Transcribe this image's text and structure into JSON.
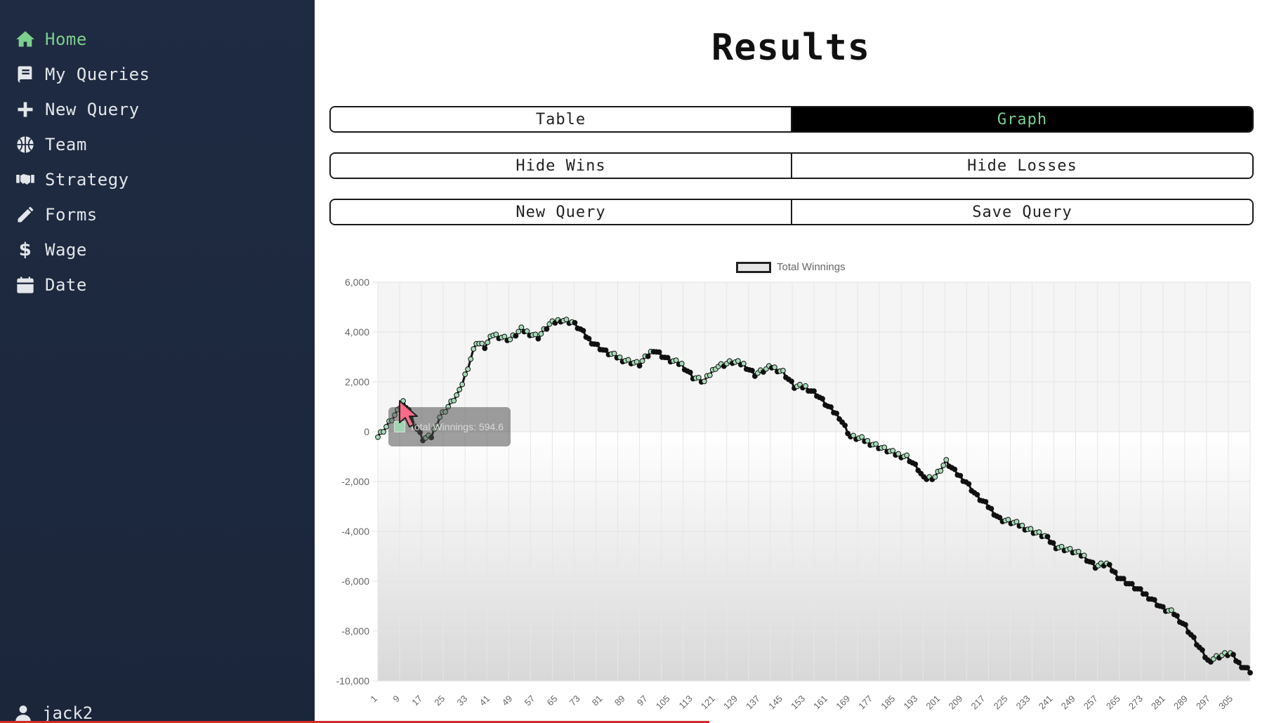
{
  "sidebar": {
    "items": [
      {
        "label": "Home",
        "icon": "home-icon",
        "active": true
      },
      {
        "label": "My Queries",
        "icon": "book-icon"
      },
      {
        "label": "New Query",
        "icon": "plus-icon"
      },
      {
        "label": "Team",
        "icon": "basketball-icon"
      },
      {
        "label": "Strategy",
        "icon": "handshake-icon"
      },
      {
        "label": "Forms",
        "icon": "pencil-icon"
      },
      {
        "label": "Wage",
        "icon": "dollar-icon"
      },
      {
        "label": "Date",
        "icon": "calendar-icon"
      }
    ],
    "user": "jack2",
    "accent": "#7ccf8d"
  },
  "main": {
    "title": "Results",
    "view_toggle": {
      "table": "Table",
      "graph": "Graph",
      "selected": "Graph"
    },
    "filters": {
      "hide_wins": "Hide Wins",
      "hide_losses": "Hide Losses"
    },
    "actions": {
      "new_query": "New Query",
      "save_query": "Save Query"
    }
  },
  "tooltip": {
    "text": "Total Winnings: 594.6"
  },
  "chart_data": {
    "type": "line",
    "series": [
      {
        "name": "Total Winnings"
      }
    ],
    "x_start": 1,
    "x_end": 311,
    "x_tick_labels": [
      "1",
      "9",
      "17",
      "25",
      "33",
      "41",
      "49",
      "57",
      "65",
      "73",
      "81",
      "89",
      "97",
      "105",
      "113",
      "121",
      "129",
      "137",
      "145",
      "153",
      "161",
      "169",
      "177",
      "185",
      "193",
      "201",
      "209",
      "217",
      "225",
      "233",
      "241",
      "249",
      "257",
      "265",
      "273",
      "281",
      "289",
      "297",
      "305"
    ],
    "y_ticks": [
      6000,
      4000,
      2000,
      0,
      -2000,
      -4000,
      -6000,
      -8000,
      -10000
    ],
    "ylim": [
      -10000,
      6000
    ],
    "trend_points": [
      [
        1,
        -200
      ],
      [
        4,
        200
      ],
      [
        8,
        800
      ],
      [
        10,
        1200
      ],
      [
        12,
        900
      ],
      [
        14,
        300
      ],
      [
        17,
        -300
      ],
      [
        20,
        -200
      ],
      [
        23,
        600
      ],
      [
        26,
        1000
      ],
      [
        30,
        1600
      ],
      [
        33,
        2600
      ],
      [
        36,
        3600
      ],
      [
        39,
        3400
      ],
      [
        42,
        3900
      ],
      [
        48,
        3700
      ],
      [
        52,
        4100
      ],
      [
        58,
        3800
      ],
      [
        62,
        4300
      ],
      [
        66,
        4500
      ],
      [
        70,
        4400
      ],
      [
        73,
        4100
      ],
      [
        76,
        3700
      ],
      [
        82,
        3200
      ],
      [
        88,
        2900
      ],
      [
        94,
        2700
      ],
      [
        99,
        3300
      ],
      [
        104,
        2900
      ],
      [
        109,
        2700
      ],
      [
        113,
        2200
      ],
      [
        117,
        2000
      ],
      [
        121,
        2600
      ],
      [
        127,
        2800
      ],
      [
        131,
        2700
      ],
      [
        135,
        2300
      ],
      [
        141,
        2600
      ],
      [
        145,
        2400
      ],
      [
        149,
        1800
      ],
      [
        153,
        1800
      ],
      [
        157,
        1500
      ],
      [
        161,
        1000
      ],
      [
        165,
        600
      ],
      [
        169,
        -200
      ],
      [
        173,
        -300
      ],
      [
        177,
        -500
      ],
      [
        181,
        -700
      ],
      [
        185,
        -900
      ],
      [
        189,
        -1000
      ],
      [
        193,
        -1500
      ],
      [
        195,
        -1900
      ],
      [
        199,
        -1800
      ],
      [
        203,
        -1200
      ],
      [
        206,
        -1600
      ],
      [
        210,
        -2000
      ],
      [
        214,
        -2600
      ],
      [
        218,
        -3000
      ],
      [
        222,
        -3500
      ],
      [
        228,
        -3700
      ],
      [
        234,
        -4000
      ],
      [
        238,
        -4200
      ],
      [
        242,
        -4600
      ],
      [
        248,
        -4800
      ],
      [
        252,
        -5000
      ],
      [
        256,
        -5400
      ],
      [
        260,
        -5300
      ],
      [
        264,
        -5800
      ],
      [
        268,
        -6100
      ],
      [
        272,
        -6400
      ],
      [
        276,
        -6700
      ],
      [
        280,
        -7100
      ],
      [
        284,
        -7300
      ],
      [
        288,
        -7800
      ],
      [
        292,
        -8500
      ],
      [
        296,
        -9200
      ],
      [
        300,
        -9000
      ],
      [
        304,
        -8900
      ],
      [
        307,
        -9300
      ],
      [
        311,
        -9600
      ]
    ]
  }
}
